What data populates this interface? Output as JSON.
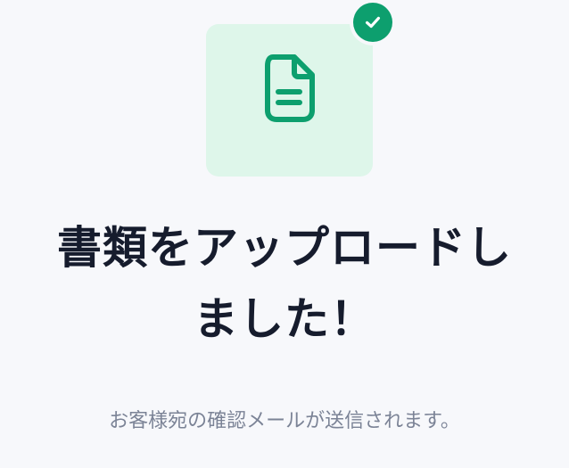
{
  "status": {
    "title_line1": "書類をアップロードし",
    "title_line2": "ました！",
    "message": "お客様宛の確認メールが送信されます。"
  },
  "icons": {
    "document": "document-icon",
    "success": "check-circle-icon"
  },
  "colors": {
    "background": "#f7f8fb",
    "tile": "#def6ea",
    "accent": "#0d9f6e",
    "title": "#161c2d",
    "subtitle": "#7b8396"
  }
}
